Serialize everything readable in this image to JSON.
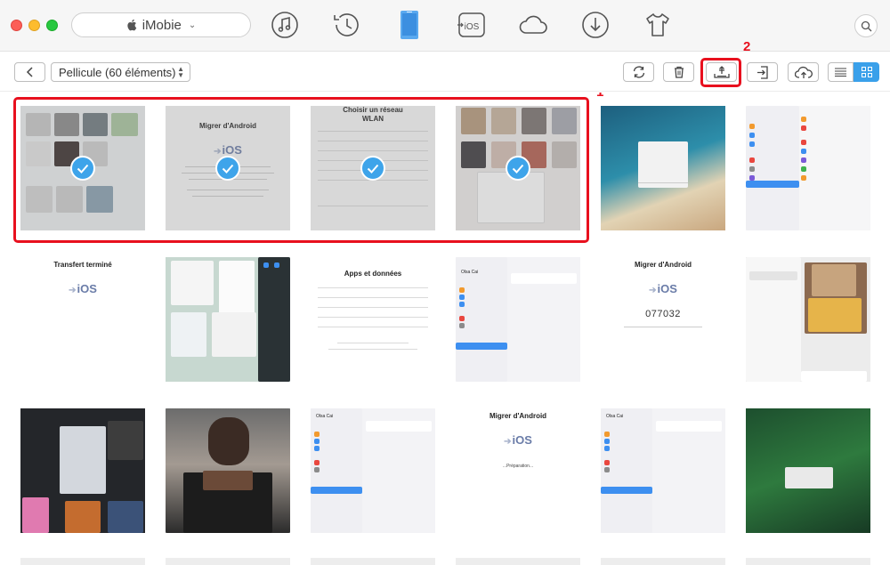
{
  "window": {
    "device_label": "iMobie",
    "nav_icons": [
      "music-note-icon",
      "history-icon",
      "device-phone-icon",
      "to-ios-icon",
      "cloud-icon",
      "download-icon",
      "tshirt-icon"
    ],
    "to_ios_label": "iOS"
  },
  "toolbar": {
    "album_label": "Pellicule (60 éléments)",
    "actions": [
      "refresh-icon",
      "trash-icon",
      "export-to-computer-icon",
      "import-icon",
      "upload-cloud-icon",
      "list-view-icon",
      "grid-view-icon"
    ],
    "annotation_1": "1",
    "annotation_2": "2"
  },
  "colors": {
    "accent": "#3aa0ea",
    "annotation_red": "#e8101e",
    "check_blue": "#3ea4ea"
  },
  "photos": {
    "p2": {
      "title": "Migrer d'Android",
      "logo": "iOS"
    },
    "p3": {
      "title_line1": "Choisir un réseau",
      "title_line2": "WLAN"
    },
    "p7": {
      "title": "Transfert terminé",
      "logo": "iOS"
    },
    "p9": {
      "title": "Apps et données"
    },
    "p11": {
      "title": "Migrer d'Android",
      "logo": "iOS",
      "code": "077032"
    },
    "p15": {
      "title": "Migrer d'Android",
      "logo": "iOS",
      "status": "...Préparation..."
    },
    "settings_profile_name": "Olsa Cai"
  }
}
